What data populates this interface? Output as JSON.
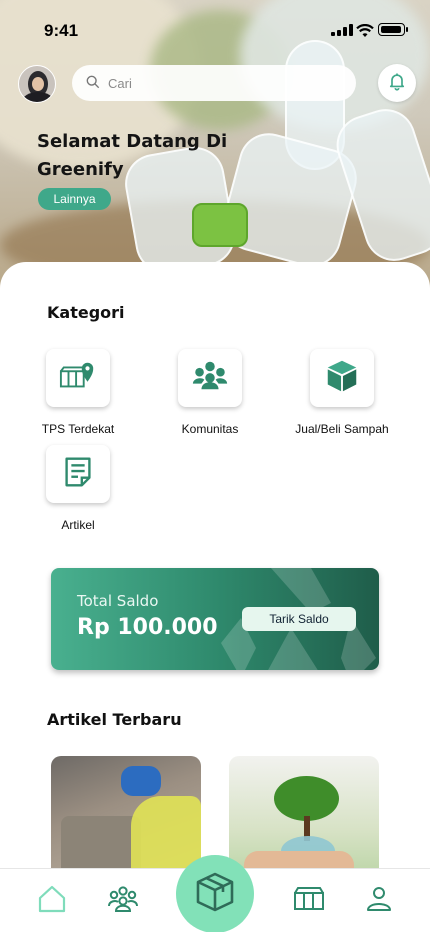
{
  "status_bar": {
    "time": "9:41"
  },
  "header": {
    "search_placeholder": "Cari",
    "welcome_title": "Selamat Datang Di Greenify",
    "more_button": "Lainnya"
  },
  "kategori": {
    "title": "Kategori",
    "items": [
      {
        "label": "TPS Terdekat",
        "icon": "map-marker-store-icon"
      },
      {
        "label": "Komunitas",
        "icon": "community-icon"
      },
      {
        "label": "Jual/Beli Sampah",
        "icon": "package-icon"
      },
      {
        "label": "Artikel",
        "icon": "article-icon"
      }
    ]
  },
  "saldo": {
    "label": "Total Saldo",
    "amount": "Rp 100.000",
    "withdraw_button": "Tarik Saldo"
  },
  "artikel": {
    "title": "Artikel Terbaru"
  },
  "nav": {
    "items": [
      {
        "icon": "home-icon",
        "active": true
      },
      {
        "icon": "community-icon",
        "active": false
      },
      {
        "icon": "package-icon",
        "active": false
      },
      {
        "icon": "store-icon",
        "active": false
      },
      {
        "icon": "profile-icon",
        "active": false
      }
    ]
  },
  "colors": {
    "accent": "#3fa88a",
    "icon_dark": "#2f8a6d",
    "fab": "#82e1b8",
    "nav_active": "#7fdcbb"
  }
}
